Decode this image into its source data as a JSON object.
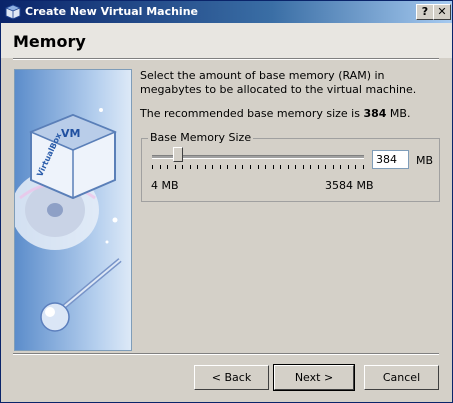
{
  "window": {
    "title": "Create New Virtual Machine"
  },
  "titlebar": {
    "help_label": "?",
    "close_label": "✕"
  },
  "header": {
    "title": "Memory"
  },
  "content": {
    "description": "Select the amount of base memory (RAM) in megabytes to be allocated to the virtual machine.",
    "recommended_prefix": "The recommended base memory size is ",
    "recommended_value": "384",
    "recommended_suffix": " MB."
  },
  "memory": {
    "group_label": "Base Memory Size",
    "value": "384",
    "unit": "MB",
    "min_label": "4 MB",
    "max_label": "3584 MB",
    "slider_value_mb": 384,
    "slider_min_mb": 4,
    "slider_max_mb": 3584
  },
  "buttons": {
    "back": "< Back",
    "next": "Next >",
    "cancel": "Cancel"
  },
  "icons": {
    "app": "virtualbox-icon",
    "side_image": "virtualbox-logo-image"
  },
  "colors": {
    "titlebar": "#0a246a",
    "face": "#d4d0c8",
    "header": "#e8e6e1"
  }
}
